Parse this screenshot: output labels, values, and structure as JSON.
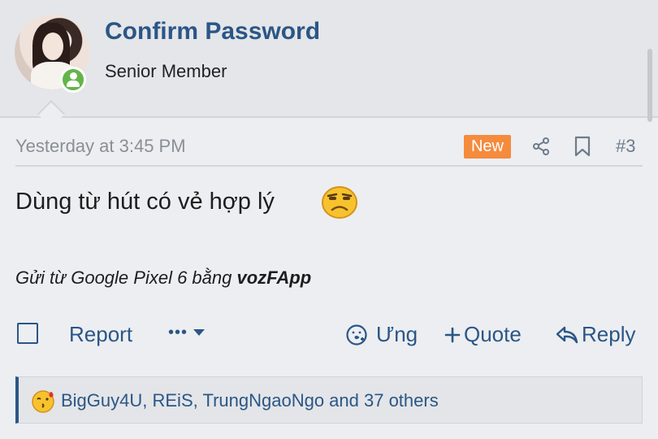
{
  "author": {
    "name": "Confirm Password",
    "title": "Senior Member",
    "status": "online"
  },
  "post": {
    "timestamp": "Yesterday at 3:45 PM",
    "badge": "New",
    "number": "#3",
    "content": "Dùng từ hút có vẻ hợp lý",
    "signature_prefix": "Gửi từ Google Pixel 6 bằng ",
    "signature_app": "vozFApp"
  },
  "actions": {
    "report": "Report",
    "more": "•••",
    "react": "Ưng",
    "quote": "Quote",
    "reply": "Reply"
  },
  "reactions": {
    "text": "BigGuy4U, REiS, TrungNgaoNgo and 37 others"
  },
  "colors": {
    "link": "#2b5686",
    "badge": "#f58b3d",
    "online": "#63b54a"
  },
  "icons": [
    "share-icon",
    "bookmark-icon",
    "react-icon",
    "plus-icon",
    "reply-icon",
    "chevron-down-icon",
    "kiss-emoji-icon",
    "annoyed-emoji-icon"
  ]
}
